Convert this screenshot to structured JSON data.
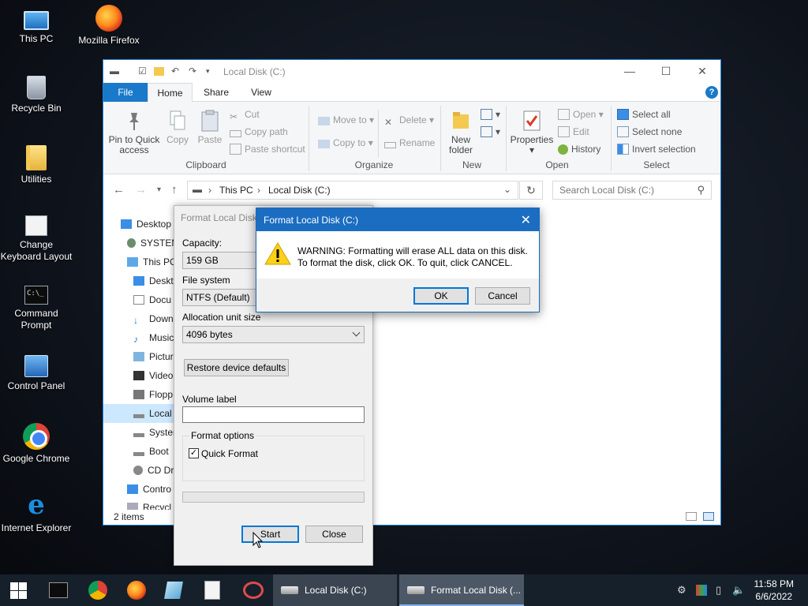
{
  "desktop": {
    "icons": [
      {
        "label": "This PC",
        "icon": "computer-icon"
      },
      {
        "label": "Mozilla Firefox",
        "icon": "firefox-icon"
      },
      {
        "label": "Recycle Bin",
        "icon": "recycle-bin-icon"
      },
      {
        "label": "Utilities",
        "icon": "folder-icon"
      },
      {
        "label": "Change Keyboard Layout",
        "icon": "keyboard-icon"
      },
      {
        "label": "Command Prompt",
        "icon": "command-prompt-icon"
      },
      {
        "label": "Control Panel",
        "icon": "control-panel-icon"
      },
      {
        "label": "Google Chrome",
        "icon": "chrome-icon"
      },
      {
        "label": "Internet Explorer",
        "icon": "internet-explorer-icon"
      }
    ]
  },
  "explorer": {
    "title": "Local Disk (C:)",
    "menu": {
      "file": "File",
      "home": "Home",
      "share": "Share",
      "view": "View"
    },
    "ribbon": {
      "pin": "Pin to Quick access",
      "copy": "Copy",
      "paste": "Paste",
      "cut": "Cut",
      "copy_path": "Copy path",
      "paste_shortcut": "Paste shortcut",
      "clipboard": "Clipboard",
      "move_to": "Move to",
      "copy_to": "Copy to",
      "delete": "Delete",
      "rename": "Rename",
      "organize": "Organize",
      "new_folder": "New folder",
      "new": "New",
      "properties": "Properties",
      "open_btn": "Open",
      "edit": "Edit",
      "history": "History",
      "open_group": "Open",
      "select_all": "Select all",
      "select_none": "Select none",
      "invert_selection": "Invert selection",
      "select": "Select"
    },
    "address": {
      "part1": "This PC",
      "part2": "Local Disk (C:)"
    },
    "search_placeholder": "Search Local Disk (C:)",
    "nav_items": [
      "Desktop",
      "SYSTEM",
      "This PC",
      "Deskt",
      "Docu",
      "Down",
      "Music",
      "Pictur",
      "Video",
      "Flopp",
      "Local",
      "Syster",
      "Boot",
      "CD Dr",
      "Contro",
      "Recycl"
    ],
    "status": "2 items"
  },
  "format_dialog": {
    "title": "Format Local Disk",
    "capacity_label": "Capacity:",
    "capacity_value": "159 GB",
    "filesystem_label": "File system",
    "filesystem_value": "NTFS (Default)",
    "alloc_label": "Allocation unit size",
    "alloc_value": "4096 bytes",
    "restore_btn": "Restore device defaults",
    "volume_label": "Volume label",
    "volume_value": "",
    "format_options": "Format options",
    "quick_format": "Quick Format",
    "quick_format_checked": true,
    "start_btn": "Start",
    "close_btn": "Close"
  },
  "warning_dialog": {
    "title": "Format Local Disk (C:)",
    "line1": "WARNING: Formatting will erase ALL data on this disk.",
    "line2": "To format the disk, click OK. To quit, click CANCEL.",
    "ok": "OK",
    "cancel": "Cancel"
  },
  "taskbar": {
    "task1": "Local Disk (C:)",
    "task2": "Format Local Disk (...",
    "time": "11:58 PM",
    "date": "6/6/2022"
  },
  "colors": {
    "accent": "#1979ca",
    "title_blue": "#1b6dc1",
    "taskbar": "#16202b",
    "selection": "#cce8ff"
  }
}
